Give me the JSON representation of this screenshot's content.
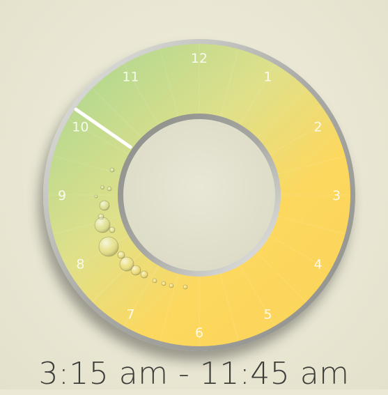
{
  "clock": {
    "hours": [
      "12",
      "1",
      "2",
      "3",
      "4",
      "5",
      "6",
      "7",
      "8",
      "9",
      "10",
      "11"
    ],
    "start_time": "3:15 am",
    "end_time": "11:45 am",
    "time_range_label": "3:15 am - 11:45 am"
  },
  "colors": {
    "background": "#ebe9d6",
    "warm_yellow": "#fdd85a",
    "cool_green": "#c8db8e",
    "bezel": "#b8b8b4",
    "hand": "#ffffff",
    "text": "#3b3b38"
  },
  "icons": {
    "bubbles": "water-bubbles-decoration",
    "hand": "clock-hand"
  }
}
